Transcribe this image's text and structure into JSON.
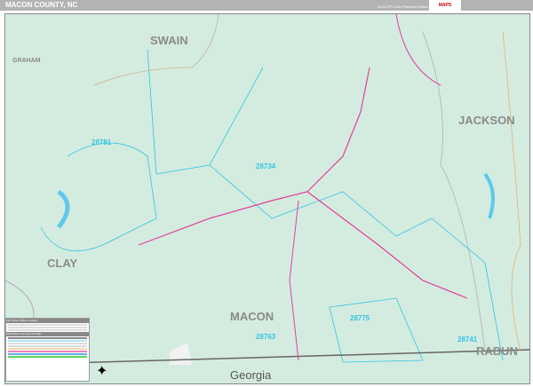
{
  "header": {
    "title": "MACON COUNTY, NC",
    "edition": "2024 ZIP Code Premium Edition",
    "logo": "MAPS"
  },
  "map": {
    "counties": [
      "SWAIN",
      "GRAHAM",
      "CLAY",
      "JACKSON",
      "MACON",
      "RABUN"
    ],
    "state": "Georgia",
    "zips": [
      "28781",
      "28734",
      "28775",
      "28763",
      "28741"
    ]
  },
  "legend": {
    "title": "ZIP Codes Within Location",
    "subtitle": "2024 Macon County, NC Map"
  },
  "colors": {
    "land": "#d4ece0",
    "zip_boundary": "#33c3e0",
    "highway": "#e0409a",
    "header": "#b3b3b3"
  }
}
